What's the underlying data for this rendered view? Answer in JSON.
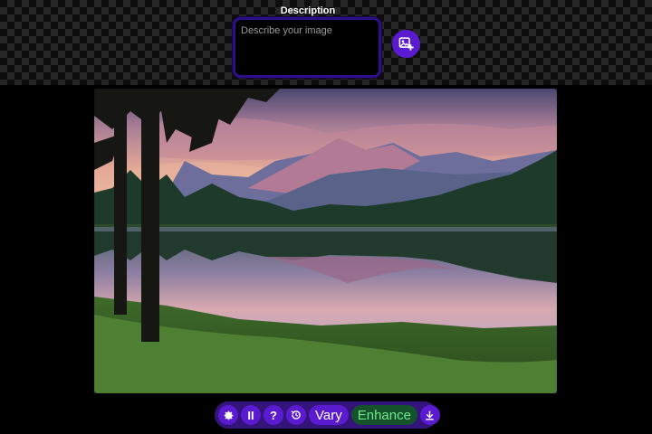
{
  "header": {
    "description_label": "Description",
    "description_placeholder": "Describe your image",
    "description_value": "",
    "add_image_icon": "image-plus-icon"
  },
  "toolbar": {
    "settings_icon": "gear-icon",
    "pause_label": "II",
    "help_label": "?",
    "history_icon": "history-icon",
    "vary_label": "Vary",
    "enhance_label": "Enhance",
    "download_icon": "download-icon"
  },
  "colors": {
    "accent_purple": "#5a1bd0",
    "toolbar_bg": "#34147a",
    "enhance_bg": "#13522a",
    "enhance_text": "#74e68a"
  }
}
